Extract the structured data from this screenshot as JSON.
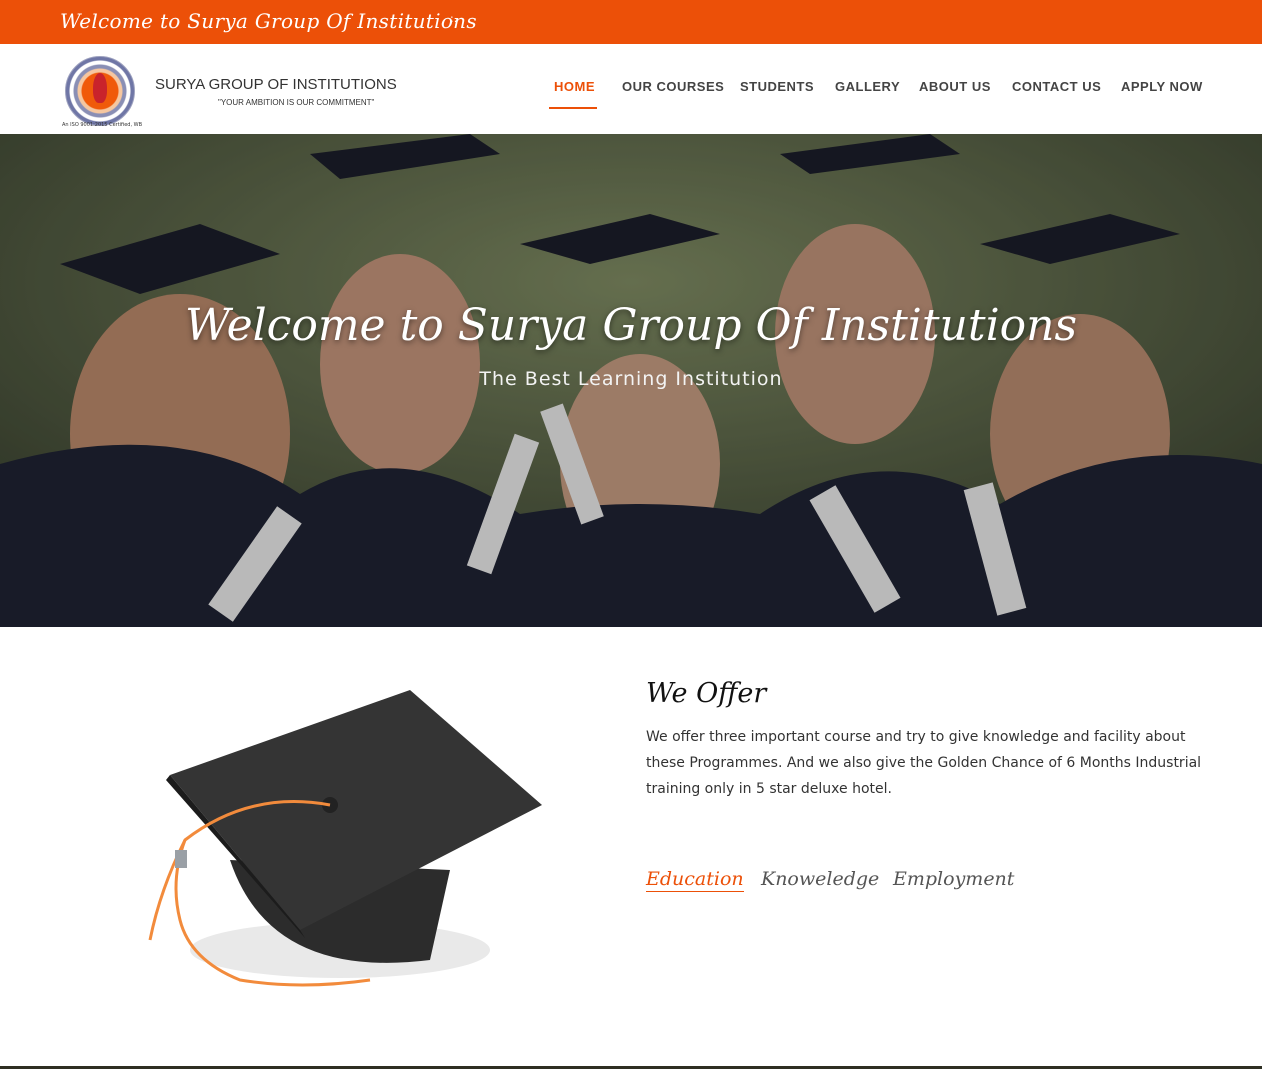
{
  "topbar": {
    "welcome": "Welcome to Surya Group Of Institutions",
    "marker": ":."
  },
  "brand": {
    "name": "SURYA GROUP OF INSTITUTIONS",
    "tagline": "\"YOUR AMBITION IS OUR COMMITMENT\"",
    "iso": "An ISO 9001:2015 Certified, WB"
  },
  "nav": {
    "items": [
      "HOME",
      "OUR COURSES",
      "STUDENTS",
      "GALLERY",
      "ABOUT US",
      "CONTACT US",
      "APPLY NOW"
    ],
    "active": "HOME"
  },
  "hero": {
    "title": "Welcome to Surya Group Of Institutions",
    "subtitle": "The Best Learning Institution"
  },
  "offer": {
    "title": "We Offer",
    "text": "We offer three important course and try to give knowledge and facility about these Programmes. And we also give the Golden Chance of 6 Months Industrial training only in 5 star deluxe hotel.",
    "tabs": [
      "Education",
      "Knoweledge",
      "Employment"
    ],
    "active_tab": "Education"
  },
  "colors": {
    "accent": "#ec5008",
    "text": "#333333"
  },
  "icons": {
    "logo": "institution-seal-icon",
    "offer_image": "graduation-cap-icon"
  }
}
